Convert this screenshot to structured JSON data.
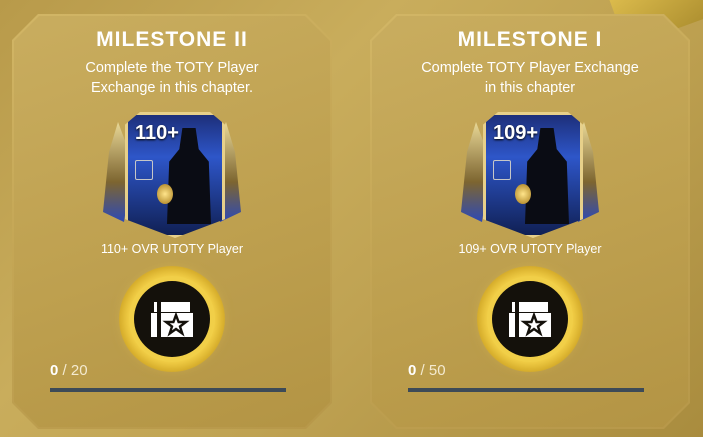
{
  "milestones": [
    {
      "title": "MILESTONE II",
      "description": "Complete the TOTY Player Exchange in this chapter.",
      "card_rating": "110+",
      "reward_label": "110+ OVR UTOTY Player",
      "progress_current": "0",
      "progress_total": "/ 20",
      "progress_fraction": 0
    },
    {
      "title": "MILESTONE I",
      "description": "Complete TOTY Player Exchange in this chapter",
      "card_rating": "109+",
      "reward_label": "109+ OVR UTOTY Player",
      "progress_current": "0",
      "progress_total": "/ 50",
      "progress_fraction": 0
    }
  ],
  "icons": {
    "pack": "pack-box-star-icon"
  },
  "colors": {
    "accent_gold": "#e7c24c",
    "card_blue": "#2e56c9",
    "bar_track": "#3d4a57"
  }
}
